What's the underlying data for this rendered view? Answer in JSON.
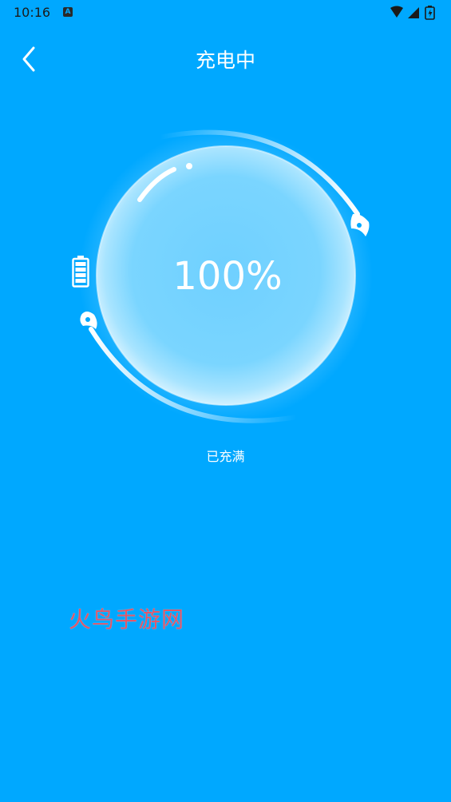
{
  "status_bar": {
    "time": "10:16",
    "app_icon": "A",
    "icons": [
      "wifi-icon",
      "signal-icon",
      "battery-charging-icon"
    ]
  },
  "header": {
    "back_icon": "chevron-left-icon",
    "title": "充电中"
  },
  "battery": {
    "icon": "battery-full-icon",
    "percent_text": "100%",
    "level": 100,
    "status_text": "已充满"
  },
  "watermark": {
    "text": "火鸟手游网"
  },
  "colors": {
    "background": "#00a8ff",
    "text": "#ffffff",
    "watermark": "#e0576a"
  }
}
